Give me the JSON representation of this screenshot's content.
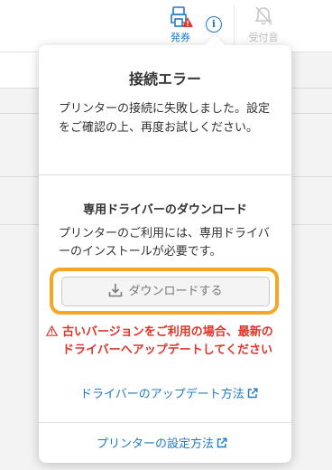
{
  "toolbar": {
    "issue_label": "発券",
    "sound_label": "受付音",
    "info_symbol": "i"
  },
  "popover": {
    "title": "接続エラー",
    "message": "プリンターの接続に失敗しました。設定をご確認の上、再度お試しください。",
    "driver_heading": "専用ドライバーのダウンロード",
    "driver_message": "プリンターのご利用には、専用ドライバーのインストールが必要です。",
    "download_button": "ダウンロードする",
    "warning_text": "古いバージョンをご利用の場合、最新のドライバーへアップデートしてください",
    "update_link": "ドライバーのアップデート方法",
    "settings_link": "プリンターの設定方法"
  },
  "colors": {
    "accent": "#1f7ac7",
    "warning": "#e0352b",
    "focus_ring": "#f5a623"
  },
  "icons": {
    "issue": "printer-ticket-icon",
    "alert_badge": "warning-triangle-icon",
    "info": "info-circle-icon",
    "sound": "bell-off-icon",
    "download": "download-tray-icon",
    "external": "external-link-icon"
  }
}
